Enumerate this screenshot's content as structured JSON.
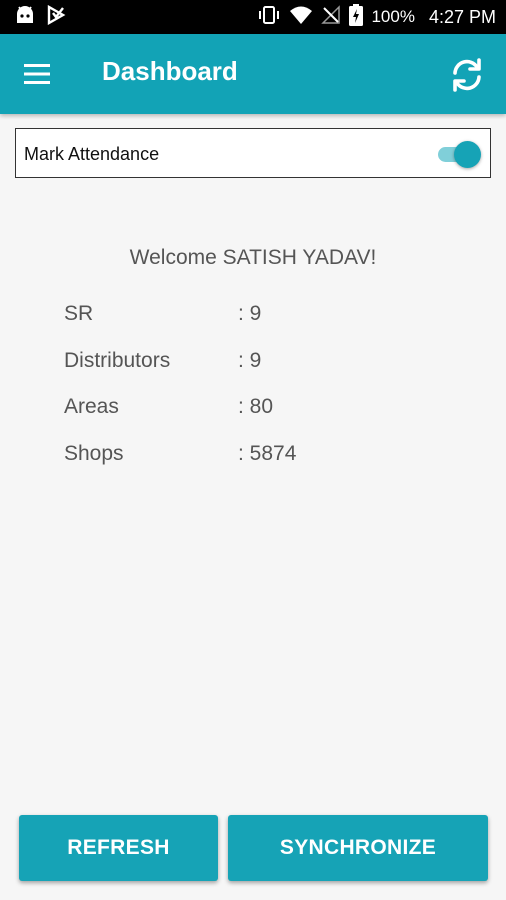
{
  "status_bar": {
    "battery_percent": "100%",
    "time": "4:27 PM",
    "icons": [
      "android-icon",
      "notification-icon",
      "vibrate-icon",
      "wifi-icon",
      "no-signal-icon",
      "battery-charging-icon"
    ]
  },
  "app_bar": {
    "title": "Dashboard",
    "menu_icon": "hamburger-menu-icon",
    "action_icon": "sync-icon"
  },
  "attendance": {
    "label": "Mark Attendance",
    "toggle_on": true
  },
  "welcome": "Welcome SATISH YADAV!",
  "stats": [
    {
      "label": "SR",
      "value": ": 9"
    },
    {
      "label": "Distributors",
      "value": ": 9"
    },
    {
      "label": "Areas",
      "value": ": 80"
    },
    {
      "label": "Shops",
      "value": ": 5874"
    }
  ],
  "buttons": {
    "refresh": "REFRESH",
    "synchronize": "SYNCHRONIZE"
  },
  "colors": {
    "primary": "#12a3b6",
    "toggle_track": "#80cfd9",
    "text_gray": "#555555"
  }
}
